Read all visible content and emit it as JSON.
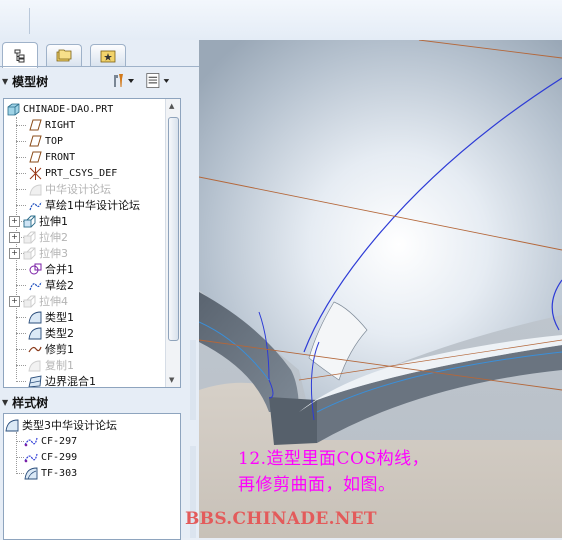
{
  "panel": {
    "tabs": [
      {
        "name": "model-tree-tab-icon"
      },
      {
        "name": "folder-browser-tab-icon"
      },
      {
        "name": "favorites-tab-icon"
      }
    ],
    "model_tree_title": "模型树",
    "style_tree_title": "样式树"
  },
  "model_tree": {
    "root": "CHINADE-DAO.PRT",
    "items": [
      {
        "label": "RIGHT",
        "icon": "datum-plane-icon",
        "dim": false,
        "expandable": false,
        "mono": true
      },
      {
        "label": "TOP",
        "icon": "datum-plane-icon",
        "dim": false,
        "expandable": false,
        "mono": true
      },
      {
        "label": "FRONT",
        "icon": "datum-plane-icon",
        "dim": false,
        "expandable": false,
        "mono": true
      },
      {
        "label": "PRT_CSYS_DEF",
        "icon": "coordinate-system-icon",
        "dim": false,
        "expandable": false,
        "mono": true
      },
      {
        "label": "中华设计论坛",
        "icon": "surface-icon",
        "dim": true,
        "expandable": false,
        "mono": false
      },
      {
        "label": "草绘1中华设计论坛",
        "icon": "sketch-icon",
        "dim": false,
        "expandable": false,
        "mono": false
      },
      {
        "label": "拉伸1",
        "icon": "extrude-icon",
        "dim": false,
        "expandable": true,
        "mono": false
      },
      {
        "label": "拉伸2",
        "icon": "extrude-icon",
        "dim": true,
        "expandable": true,
        "mono": false
      },
      {
        "label": "拉伸3",
        "icon": "extrude-icon",
        "dim": true,
        "expandable": true,
        "mono": false
      },
      {
        "label": "合并1",
        "icon": "merge-icon",
        "dim": false,
        "expandable": false,
        "mono": false
      },
      {
        "label": "草绘2",
        "icon": "sketch-icon",
        "dim": false,
        "expandable": false,
        "mono": false
      },
      {
        "label": "拉伸4",
        "icon": "extrude-icon",
        "dim": true,
        "expandable": true,
        "mono": false
      },
      {
        "label": "类型1",
        "icon": "style-surface-icon",
        "dim": false,
        "expandable": false,
        "mono": false
      },
      {
        "label": "类型2",
        "icon": "style-surface-icon",
        "dim": false,
        "expandable": false,
        "mono": false
      },
      {
        "label": "修剪1",
        "icon": "trim-icon",
        "dim": false,
        "expandable": false,
        "mono": false
      },
      {
        "label": "复制1",
        "icon": "copy-icon",
        "dim": true,
        "expandable": false,
        "mono": false
      },
      {
        "label": "边界混合1",
        "icon": "boundary-blend-icon",
        "dim": false,
        "expandable": false,
        "mono": false
      }
    ]
  },
  "style_tree": {
    "root": "类型3中华设计论坛",
    "items": [
      {
        "label": "CF-297",
        "icon": "curve-free-icon"
      },
      {
        "label": "CF-299",
        "icon": "curve-free-icon"
      },
      {
        "label": "TF-303",
        "icon": "trimmed-surface-icon"
      }
    ]
  },
  "annotation": {
    "line1": "12.造型里面COS构线，",
    "line2": "再修剪曲面，如图。",
    "color": "#ff00ff"
  },
  "watermark": "BBS.CHINADE.NET",
  "colors": {
    "curve": "#2d3bd6",
    "datum": "#b4673a",
    "panel_bg": "#e6edf6"
  }
}
